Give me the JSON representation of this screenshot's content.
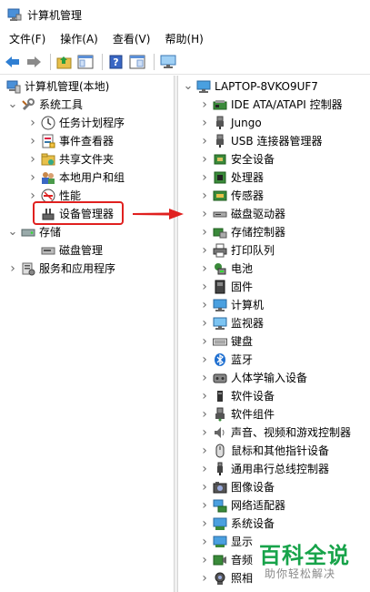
{
  "window": {
    "title": "计算机管理"
  },
  "menu": [
    "文件(F)",
    "操作(A)",
    "查看(V)",
    "帮助(H)"
  ],
  "toolbar": {
    "buttons": [
      "back-arrow-icon",
      "forward-arrow-icon",
      "up-folder-icon",
      "show-tree-icon",
      "help-icon",
      "properties-icon",
      "monitor-icon"
    ]
  },
  "left_tree": [
    {
      "label": "计算机管理(本地)",
      "level": 0,
      "expander": "",
      "icon": "computer-management-icon"
    },
    {
      "label": "系统工具",
      "level": 1,
      "expander": "open",
      "icon": "tools-icon"
    },
    {
      "label": "任务计划程序",
      "level": 2,
      "expander": "closed",
      "icon": "clock-icon"
    },
    {
      "label": "事件查看器",
      "level": 2,
      "expander": "closed",
      "icon": "event-viewer-icon"
    },
    {
      "label": "共享文件夹",
      "level": 2,
      "expander": "closed",
      "icon": "shared-folder-icon"
    },
    {
      "label": "本地用户和组",
      "level": 2,
      "expander": "closed",
      "icon": "users-icon"
    },
    {
      "label": "性能",
      "level": 2,
      "expander": "closed",
      "icon": "performance-icon"
    },
    {
      "label": "设备管理器",
      "level": 2,
      "expander": "",
      "icon": "device-manager-icon"
    },
    {
      "label": "存储",
      "level": 1,
      "expander": "open",
      "icon": "storage-icon"
    },
    {
      "label": "磁盘管理",
      "level": 2,
      "expander": "",
      "icon": "disk-management-icon"
    },
    {
      "label": "服务和应用程序",
      "level": 1,
      "expander": "closed",
      "icon": "services-icon"
    }
  ],
  "right_tree": {
    "root": "LAPTOP-8VKO9UF7",
    "items": [
      {
        "label": "IDE ATA/ATAPI 控制器",
        "icon": "ide-controller-icon"
      },
      {
        "label": "Jungo",
        "icon": "usb-plug-icon"
      },
      {
        "label": "USB 连接器管理器",
        "icon": "usb-plug-icon"
      },
      {
        "label": "安全设备",
        "icon": "security-device-icon"
      },
      {
        "label": "处理器",
        "icon": "processor-icon"
      },
      {
        "label": "传感器",
        "icon": "sensor-icon"
      },
      {
        "label": "磁盘驱动器",
        "icon": "disk-drive-icon"
      },
      {
        "label": "存储控制器",
        "icon": "storage-controller-icon"
      },
      {
        "label": "打印队列",
        "icon": "printer-icon"
      },
      {
        "label": "电池",
        "icon": "battery-icon"
      },
      {
        "label": "固件",
        "icon": "firmware-icon"
      },
      {
        "label": "计算机",
        "icon": "computer-icon"
      },
      {
        "label": "监视器",
        "icon": "monitor-icon"
      },
      {
        "label": "键盘",
        "icon": "keyboard-icon"
      },
      {
        "label": "蓝牙",
        "icon": "bluetooth-icon"
      },
      {
        "label": "人体学输入设备",
        "icon": "hid-icon"
      },
      {
        "label": "软件设备",
        "icon": "software-device-icon"
      },
      {
        "label": "软件组件",
        "icon": "software-component-icon"
      },
      {
        "label": "声音、视频和游戏控制器",
        "icon": "speaker-icon"
      },
      {
        "label": "鼠标和其他指针设备",
        "icon": "mouse-icon"
      },
      {
        "label": "通用串行总线控制器",
        "icon": "usb-icon"
      },
      {
        "label": "图像设备",
        "icon": "camera-icon"
      },
      {
        "label": "网络适配器",
        "icon": "network-adapter-icon"
      },
      {
        "label": "系统设备",
        "icon": "system-device-icon"
      },
      {
        "label": "显示",
        "icon": "display-adapter-icon"
      },
      {
        "label": "音频",
        "icon": "audio-icon"
      },
      {
        "label": "照相",
        "icon": "webcam-icon"
      }
    ]
  },
  "watermark": {
    "main": "百科全说",
    "sub": "助你轻松解决"
  },
  "colors": {
    "highlight": "#e0201f",
    "watermark_green": "#17a34a",
    "arrow": "#e0201f"
  }
}
